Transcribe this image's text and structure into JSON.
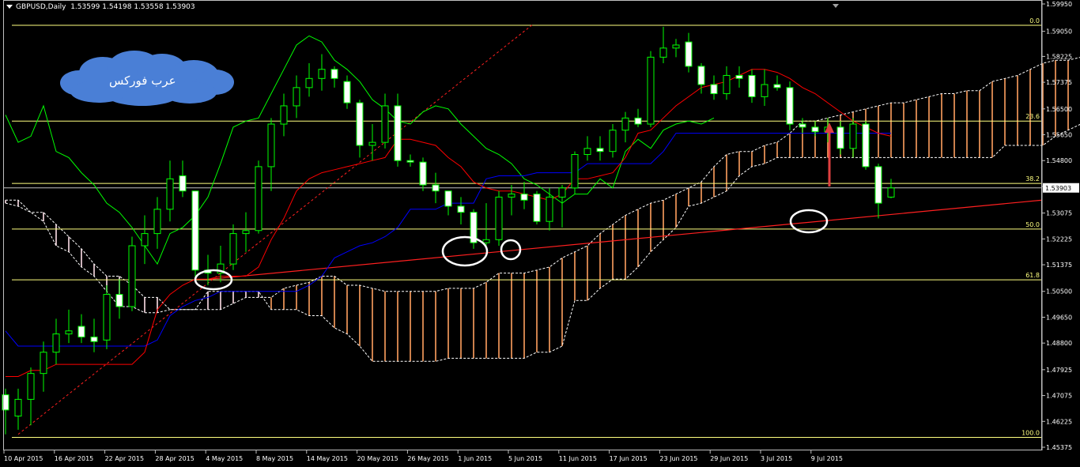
{
  "header": {
    "symbol_timeframe": "GBPUSD,Daily",
    "ohlc": "1.53599 1.54198 1.53558 1.53903"
  },
  "logo_text": "عرب فوركس",
  "colors": {
    "background": "#000000",
    "candle_up_body": "#000000",
    "candle_down_body": "#ffffff",
    "candle_border": "#00ff00",
    "tenkan_sen": "#ff0000",
    "kijun_sen": "#0000ff",
    "chikou_span": "#00ff00",
    "kumo_bull_hatch": "#ffa060",
    "kumo_bear_hatch": "#ffe0e8",
    "fibo_level": "#ffff80",
    "trendline_red": "#ff2020",
    "arrow": "#e04040",
    "highlight_ellipse": "#ffffff",
    "cloud_logo": "#4a7fd6"
  },
  "chart_data": {
    "type": "candlestick",
    "symbol": "GBPUSD",
    "timeframe": "Daily",
    "ylim": [
      1.45375,
      1.5995
    ],
    "y_ticks": [
      "1.59950",
      "1.59050",
      "1.58225",
      "1.57375",
      "1.56500",
      "1.55650",
      "1.54800",
      "1.53950",
      "1.53075",
      "1.52225",
      "1.51375",
      "1.50500",
      "1.49650",
      "1.48800",
      "1.47925",
      "1.47075",
      "1.46225",
      "1.45375"
    ],
    "current_price": "1.53903",
    "x_tick_labels": [
      "10 Apr 2015",
      "16 Apr 2015",
      "22 Apr 2015",
      "28 Apr 2015",
      "4 May 2015",
      "8 May 2015",
      "14 May 2015",
      "20 May 2015",
      "26 May 2015",
      "1 Jun 2015",
      "5 Jun 2015",
      "11 Jun 2015",
      "17 Jun 2015",
      "23 Jun 2015",
      "29 Jun 2015",
      "3 Jul 2015",
      "9 Jul 2015"
    ],
    "fibonacci_levels": [
      {
        "label": "0.0",
        "price": 1.5925
      },
      {
        "label": "23.6",
        "price": 1.561
      },
      {
        "label": "38.2",
        "price": 1.5405
      },
      {
        "label": "50.0",
        "price": 1.5255
      },
      {
        "label": "61.8",
        "price": 1.5088
      },
      {
        "label": "100.0",
        "price": 1.457
      }
    ],
    "candles": [
      {
        "o": 1.471,
        "h": 1.473,
        "l": 1.458,
        "c": 1.466
      },
      {
        "o": 1.464,
        "h": 1.473,
        "l": 1.4595,
        "c": 1.4695
      },
      {
        "o": 1.4695,
        "h": 1.48,
        "l": 1.461,
        "c": 1.478
      },
      {
        "o": 1.478,
        "h": 1.4885,
        "l": 1.472,
        "c": 1.485
      },
      {
        "o": 1.485,
        "h": 1.496,
        "l": 1.481,
        "c": 1.491
      },
      {
        "o": 1.491,
        "h": 1.499,
        "l": 1.488,
        "c": 1.492
      },
      {
        "o": 1.4935,
        "h": 1.4975,
        "l": 1.488,
        "c": 1.49
      },
      {
        "o": 1.49,
        "h": 1.496,
        "l": 1.485,
        "c": 1.4885
      },
      {
        "o": 1.489,
        "h": 1.507,
        "l": 1.486,
        "c": 1.504
      },
      {
        "o": 1.504,
        "h": 1.509,
        "l": 1.496,
        "c": 1.5
      },
      {
        "o": 1.5,
        "h": 1.523,
        "l": 1.4985,
        "c": 1.52
      },
      {
        "o": 1.52,
        "h": 1.53,
        "l": 1.514,
        "c": 1.524
      },
      {
        "o": 1.524,
        "h": 1.536,
        "l": 1.519,
        "c": 1.532
      },
      {
        "o": 1.532,
        "h": 1.548,
        "l": 1.528,
        "c": 1.542
      },
      {
        "o": 1.543,
        "h": 1.548,
        "l": 1.536,
        "c": 1.538
      },
      {
        "o": 1.538,
        "h": 1.537,
        "l": 1.509,
        "c": 1.512
      },
      {
        "o": 1.512,
        "h": 1.517,
        "l": 1.507,
        "c": 1.511
      },
      {
        "o": 1.511,
        "h": 1.52,
        "l": 1.508,
        "c": 1.514
      },
      {
        "o": 1.514,
        "h": 1.527,
        "l": 1.512,
        "c": 1.524
      },
      {
        "o": 1.524,
        "h": 1.531,
        "l": 1.518,
        "c": 1.525
      },
      {
        "o": 1.525,
        "h": 1.548,
        "l": 1.524,
        "c": 1.546
      },
      {
        "o": 1.546,
        "h": 1.562,
        "l": 1.538,
        "c": 1.56
      },
      {
        "o": 1.56,
        "h": 1.57,
        "l": 1.556,
        "c": 1.566
      },
      {
        "o": 1.566,
        "h": 1.576,
        "l": 1.562,
        "c": 1.572
      },
      {
        "o": 1.572,
        "h": 1.58,
        "l": 1.569,
        "c": 1.575
      },
      {
        "o": 1.575,
        "h": 1.583,
        "l": 1.571,
        "c": 1.578
      },
      {
        "o": 1.578,
        "h": 1.579,
        "l": 1.572,
        "c": 1.575
      },
      {
        "o": 1.574,
        "h": 1.576,
        "l": 1.565,
        "c": 1.567
      },
      {
        "o": 1.567,
        "h": 1.568,
        "l": 1.549,
        "c": 1.553
      },
      {
        "o": 1.553,
        "h": 1.56,
        "l": 1.548,
        "c": 1.554
      },
      {
        "o": 1.554,
        "h": 1.57,
        "l": 1.552,
        "c": 1.566
      },
      {
        "o": 1.566,
        "h": 1.57,
        "l": 1.546,
        "c": 1.548
      },
      {
        "o": 1.548,
        "h": 1.55,
        "l": 1.546,
        "c": 1.5475
      },
      {
        "o": 1.5475,
        "h": 1.549,
        "l": 1.538,
        "c": 1.54
      },
      {
        "o": 1.54,
        "h": 1.544,
        "l": 1.534,
        "c": 1.538
      },
      {
        "o": 1.538,
        "h": 1.538,
        "l": 1.53,
        "c": 1.533
      },
      {
        "o": 1.533,
        "h": 1.536,
        "l": 1.527,
        "c": 1.531
      },
      {
        "o": 1.531,
        "h": 1.532,
        "l": 1.519,
        "c": 1.521
      },
      {
        "o": 1.521,
        "h": 1.534,
        "l": 1.519,
        "c": 1.522
      },
      {
        "o": 1.522,
        "h": 1.538,
        "l": 1.52,
        "c": 1.536
      },
      {
        "o": 1.536,
        "h": 1.54,
        "l": 1.53,
        "c": 1.537
      },
      {
        "o": 1.537,
        "h": 1.541,
        "l": 1.532,
        "c": 1.535
      },
      {
        "o": 1.537,
        "h": 1.538,
        "l": 1.527,
        "c": 1.528
      },
      {
        "o": 1.528,
        "h": 1.539,
        "l": 1.525,
        "c": 1.536
      },
      {
        "o": 1.536,
        "h": 1.54,
        "l": 1.526,
        "c": 1.539
      },
      {
        "o": 1.539,
        "h": 1.551,
        "l": 1.537,
        "c": 1.55
      },
      {
        "o": 1.55,
        "h": 1.556,
        "l": 1.548,
        "c": 1.552
      },
      {
        "o": 1.552,
        "h": 1.556,
        "l": 1.548,
        "c": 1.551
      },
      {
        "o": 1.551,
        "h": 1.56,
        "l": 1.549,
        "c": 1.558
      },
      {
        "o": 1.558,
        "h": 1.564,
        "l": 1.554,
        "c": 1.562
      },
      {
        "o": 1.562,
        "h": 1.565,
        "l": 1.559,
        "c": 1.56
      },
      {
        "o": 1.56,
        "h": 1.584,
        "l": 1.559,
        "c": 1.582
      },
      {
        "o": 1.582,
        "h": 1.592,
        "l": 1.58,
        "c": 1.585
      },
      {
        "o": 1.585,
        "h": 1.588,
        "l": 1.582,
        "c": 1.586
      },
      {
        "o": 1.587,
        "h": 1.59,
        "l": 1.577,
        "c": 1.579
      },
      {
        "o": 1.579,
        "h": 1.58,
        "l": 1.57,
        "c": 1.573
      },
      {
        "o": 1.573,
        "h": 1.576,
        "l": 1.568,
        "c": 1.57
      },
      {
        "o": 1.57,
        "h": 1.579,
        "l": 1.568,
        "c": 1.576
      },
      {
        "o": 1.576,
        "h": 1.579,
        "l": 1.572,
        "c": 1.575
      },
      {
        "o": 1.576,
        "h": 1.578,
        "l": 1.567,
        "c": 1.569
      },
      {
        "o": 1.569,
        "h": 1.578,
        "l": 1.566,
        "c": 1.573
      },
      {
        "o": 1.573,
        "h": 1.576,
        "l": 1.571,
        "c": 1.572
      },
      {
        "o": 1.572,
        "h": 1.574,
        "l": 1.558,
        "c": 1.56
      },
      {
        "o": 1.56,
        "h": 1.562,
        "l": 1.557,
        "c": 1.559
      },
      {
        "o": 1.559,
        "h": 1.561,
        "l": 1.556,
        "c": 1.5575
      },
      {
        "o": 1.5575,
        "h": 1.562,
        "l": 1.554,
        "c": 1.559
      },
      {
        "o": 1.559,
        "h": 1.561,
        "l": 1.55,
        "c": 1.552
      },
      {
        "o": 1.552,
        "h": 1.562,
        "l": 1.549,
        "c": 1.56
      },
      {
        "o": 1.56,
        "h": 1.561,
        "l": 1.545,
        "c": 1.546
      },
      {
        "o": 1.546,
        "h": 1.547,
        "l": 1.529,
        "c": 1.534
      },
      {
        "o": 1.536,
        "h": 1.542,
        "l": 1.5356,
        "c": 1.539
      }
    ],
    "tenkan_sen": [
      1.477,
      1.477,
      1.479,
      1.479,
      1.481,
      1.481,
      1.481,
      1.481,
      1.481,
      1.481,
      1.481,
      1.485,
      1.499,
      1.504,
      1.507,
      1.509,
      1.509,
      1.51,
      1.51,
      1.51,
      1.513,
      1.522,
      1.529,
      1.538,
      1.542,
      1.544,
      1.545,
      1.546,
      1.547,
      1.548,
      1.549,
      1.555,
      1.555,
      1.554,
      1.553,
      1.549,
      1.546,
      1.541,
      1.539,
      1.538,
      1.538,
      1.537,
      1.536,
      1.535,
      1.537,
      1.542,
      1.542,
      1.543,
      1.544,
      1.549,
      1.557,
      1.558,
      1.562,
      1.566,
      1.569,
      1.572,
      1.573,
      1.574,
      1.576,
      1.578,
      1.578,
      1.577,
      1.575,
      1.572,
      1.57,
      1.567,
      1.564,
      1.561,
      1.559,
      1.557,
      1.556
    ],
    "kijun_sen": [
      1.492,
      1.487,
      1.487,
      1.487,
      1.487,
      1.487,
      1.487,
      1.487,
      1.487,
      1.487,
      1.487,
      1.487,
      1.489,
      1.497,
      1.5,
      1.502,
      1.503,
      1.505,
      1.505,
      1.505,
      1.505,
      1.505,
      1.505,
      1.505,
      1.507,
      1.51,
      1.516,
      1.518,
      1.52,
      1.521,
      1.523,
      1.526,
      1.532,
      1.532,
      1.532,
      1.534,
      1.534,
      1.534,
      1.542,
      1.543,
      1.543,
      1.543,
      1.544,
      1.544,
      1.544,
      1.544,
      1.547,
      1.547,
      1.547,
      1.547,
      1.547,
      1.547,
      1.551,
      1.557,
      1.557,
      1.557,
      1.557,
      1.557,
      1.557,
      1.557,
      1.557,
      1.557,
      1.557,
      1.557,
      1.557,
      1.557,
      1.557,
      1.557,
      1.557,
      1.557,
      1.557
    ],
    "chikou_span": [
      1.563,
      1.554,
      1.556,
      1.566,
      1.551,
      1.549,
      1.544,
      1.54,
      1.534,
      1.531,
      1.526,
      1.52,
      1.514,
      1.524,
      1.526,
      1.53,
      1.536,
      1.547,
      1.559,
      1.561,
      1.562,
      1.57,
      1.578,
      1.586,
      1.589,
      1.587,
      1.581,
      1.578,
      1.574,
      1.568,
      1.565,
      1.561,
      1.56,
      1.564,
      1.566,
      1.565,
      1.56,
      1.556,
      1.552,
      1.55,
      1.547,
      1.542,
      1.54,
      1.537,
      1.534,
      1.537,
      1.537,
      1.542,
      1.539,
      1.551,
      1.555,
      1.552,
      1.558,
      1.56,
      1.561,
      1.56,
      1.562
    ],
    "senkou_span_a": [
      1.534,
      1.533,
      1.531,
      1.528,
      1.52,
      1.518,
      1.513,
      1.51,
      1.505,
      1.5,
      1.5,
      1.498,
      1.498,
      1.499,
      1.499,
      1.499,
      1.499,
      1.499,
      1.501,
      1.503,
      1.503,
      1.503,
      1.506,
      1.507,
      1.508,
      1.51,
      1.51,
      1.507,
      1.507,
      1.506,
      1.505,
      1.505,
      1.505,
      1.505,
      1.505,
      1.506,
      1.506,
      1.506,
      1.508,
      1.511,
      1.511,
      1.511,
      1.512,
      1.513,
      1.516,
      1.518,
      1.52,
      1.524,
      1.527,
      1.53,
      1.532,
      1.534,
      1.535,
      1.537,
      1.539,
      1.541,
      1.546,
      1.55,
      1.551,
      1.551,
      1.553,
      1.554,
      1.557,
      1.561,
      1.561,
      1.562,
      1.563,
      1.564,
      1.565,
      1.566,
      1.567,
      1.567,
      1.568,
      1.569,
      1.57,
      1.57,
      1.571,
      1.571,
      1.574,
      1.575,
      1.576,
      1.578,
      1.58,
      1.581,
      1.581,
      1.582,
      1.583,
      1.584,
      1.585,
      1.586
    ],
    "senkou_span_b": [
      1.535,
      1.535,
      1.531,
      1.531,
      1.527,
      1.523,
      1.519,
      1.514,
      1.51,
      1.51,
      1.507,
      1.503,
      1.503,
      1.499,
      1.499,
      1.499,
      1.505,
      1.505,
      1.505,
      1.505,
      1.505,
      1.499,
      1.499,
      1.499,
      1.497,
      1.497,
      1.493,
      1.491,
      1.487,
      1.482,
      1.482,
      1.482,
      1.482,
      1.482,
      1.482,
      1.483,
      1.483,
      1.483,
      1.483,
      1.483,
      1.483,
      1.483,
      1.485,
      1.485,
      1.487,
      1.502,
      1.502,
      1.506,
      1.509,
      1.509,
      1.513,
      1.518,
      1.522,
      1.526,
      1.533,
      1.534,
      1.536,
      1.538,
      1.543,
      1.546,
      1.547,
      1.549,
      1.549,
      1.549,
      1.549,
      1.549,
      1.549,
      1.549,
      1.549,
      1.549,
      1.549,
      1.549,
      1.549,
      1.549,
      1.549,
      1.549,
      1.549,
      1.549,
      1.549,
      1.553,
      1.553,
      1.553,
      1.553,
      1.556,
      1.558,
      1.56,
      1.562,
      1.564,
      1.566,
      1.568
    ]
  }
}
